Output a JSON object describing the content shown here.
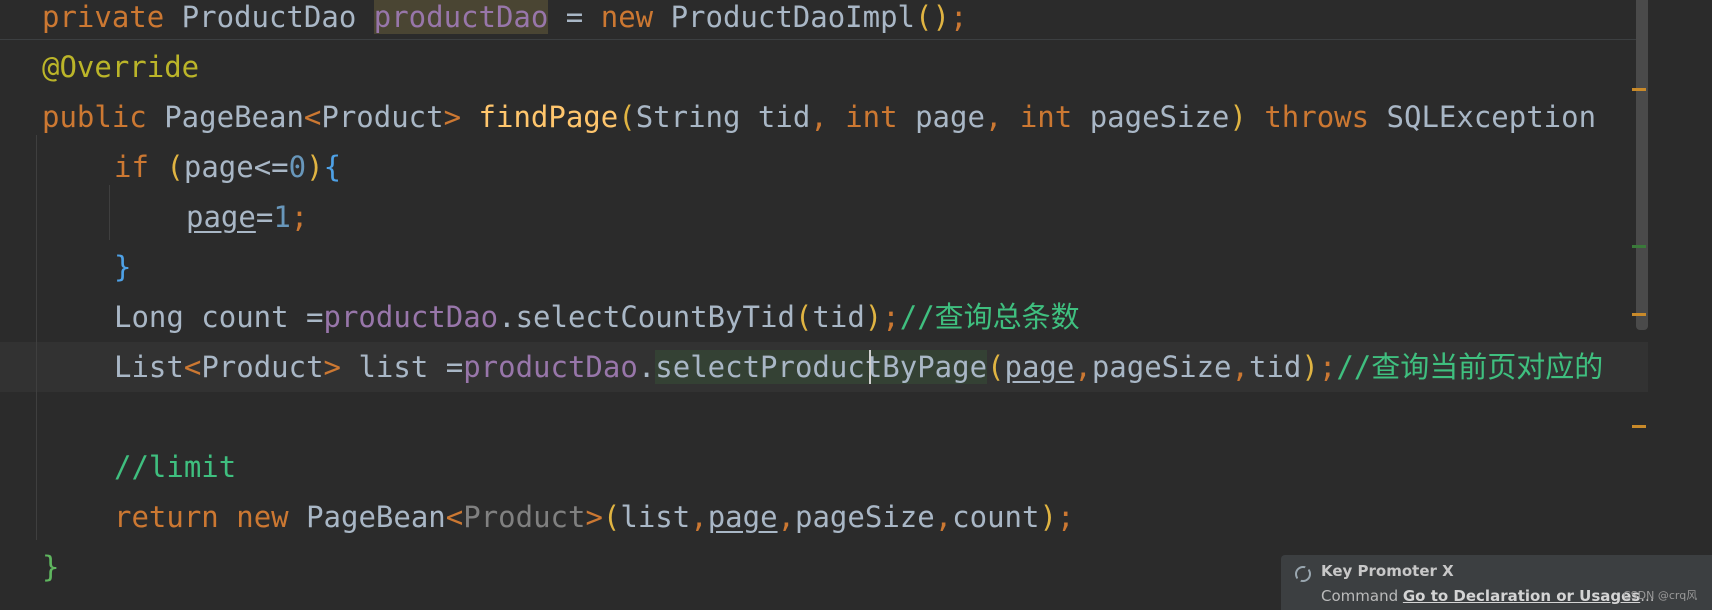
{
  "editor": {
    "lines": [
      {
        "tokens": [
          "private",
          " ProductDao ",
          "productDao",
          " = ",
          "new",
          " ProductDaoImpl",
          "()",
          ";"
        ]
      },
      {
        "tokens": [
          "@Override"
        ]
      },
      {
        "tokens": [
          "public",
          " PageBean",
          "<",
          "Product",
          ">",
          " ",
          "findPage",
          "(",
          "String tid",
          ", ",
          "int",
          " page",
          ", ",
          "int",
          " pageSize",
          ")",
          " ",
          "throws",
          " SQLException"
        ]
      },
      {
        "tokens": [
          "if",
          " ",
          "(",
          "page<=",
          "0",
          ")",
          "{"
        ]
      },
      {
        "tokens": [
          "page",
          "=",
          "1",
          ";"
        ]
      },
      {
        "tokens": [
          "}"
        ]
      },
      {
        "tokens": [
          "Long count =",
          "productDao",
          ".selectCountByTid",
          "(",
          "tid",
          ")",
          ";",
          "//查询总条数"
        ]
      },
      {
        "tokens": [
          "List",
          "<",
          "Product",
          ">",
          " list =",
          "productDao",
          ".",
          "selectProdu",
          "ctByPage",
          "(",
          "page",
          ",",
          "pageSize",
          ",",
          "tid",
          ")",
          ";",
          "//查询当前页对应的"
        ]
      },
      {
        "tokens": []
      },
      {
        "tokens": [
          "//limit"
        ]
      },
      {
        "tokens": [
          "return",
          " ",
          "new",
          " PageBean",
          "<",
          "Product",
          ">",
          "(",
          "list",
          ",",
          "page",
          ",",
          "pageSize",
          ",",
          "count",
          ")",
          ";"
        ]
      },
      {
        "tokens": [
          "}"
        ]
      }
    ]
  },
  "colors": {
    "background": "#2b2b2b",
    "keyword": "#cc7832",
    "field": "#9876aa",
    "method": "#ffc66d",
    "annotation": "#bbb529",
    "number": "#6897bb",
    "comment": "#3fbf7f"
  },
  "popup": {
    "icon": "key-promoter-icon",
    "title": "Key Promoter X",
    "message_prefix": "Command ",
    "action": "Go to Declaration or Usages",
    "ellipsis": "..."
  },
  "watermark": "CSDN @crq风"
}
